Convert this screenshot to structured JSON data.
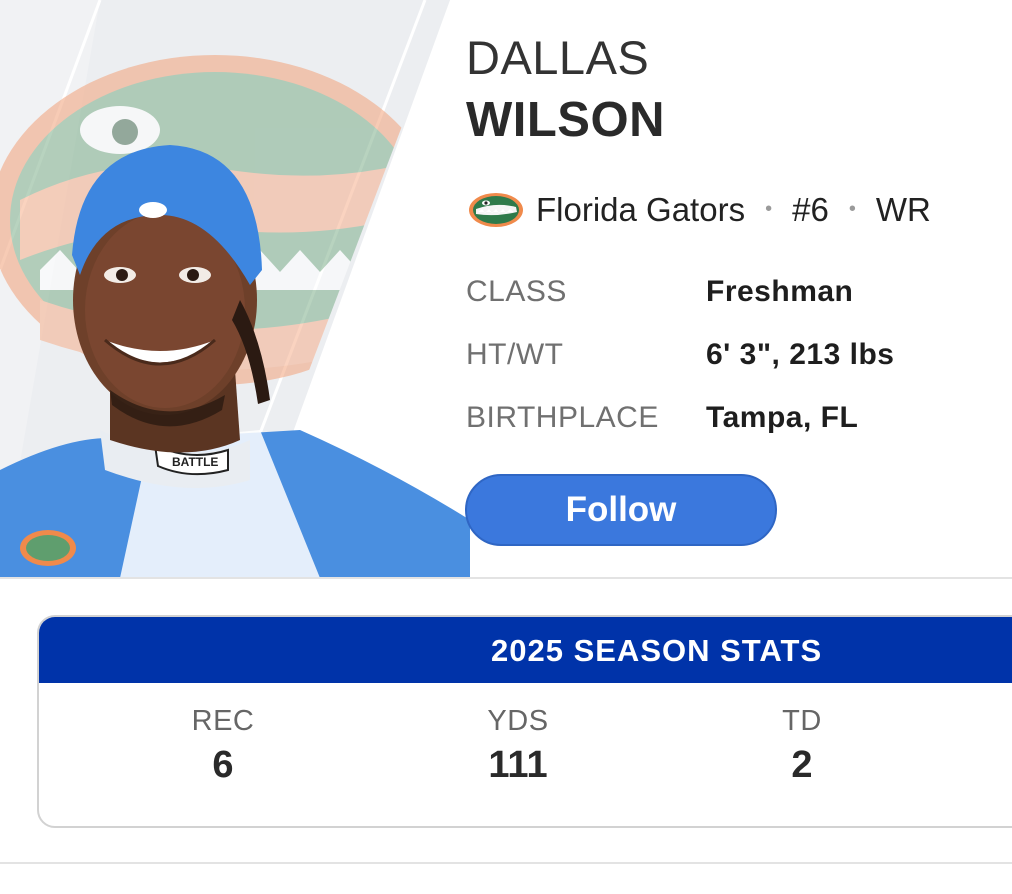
{
  "player": {
    "first_name": "DALLAS",
    "last_name": "WILSON",
    "team": "Florida Gators",
    "number": "#6",
    "position": "WR",
    "separator": "•"
  },
  "details": [
    {
      "label": "CLASS",
      "value": "Freshman"
    },
    {
      "label": "HT/WT",
      "value": "6' 3\", 213 lbs"
    },
    {
      "label": "BIRTHPLACE",
      "value": "Tampa, FL"
    }
  ],
  "follow_label": "Follow",
  "stats": {
    "title": "2025 SEASON STATS",
    "items": [
      {
        "label": "REC",
        "value": "6"
      },
      {
        "label": "YDS",
        "value": "111"
      },
      {
        "label": "TD",
        "value": "2"
      }
    ]
  },
  "colors": {
    "follow_button": "#3b78dd",
    "stats_header": "#0033a9",
    "gator_green": "#5f9e6e",
    "gator_orange": "#f08a4b",
    "cap_blue": "#3d86e0"
  },
  "icons": {
    "team_logo": "gator-logo-icon",
    "player_photo": "player-headshot"
  }
}
